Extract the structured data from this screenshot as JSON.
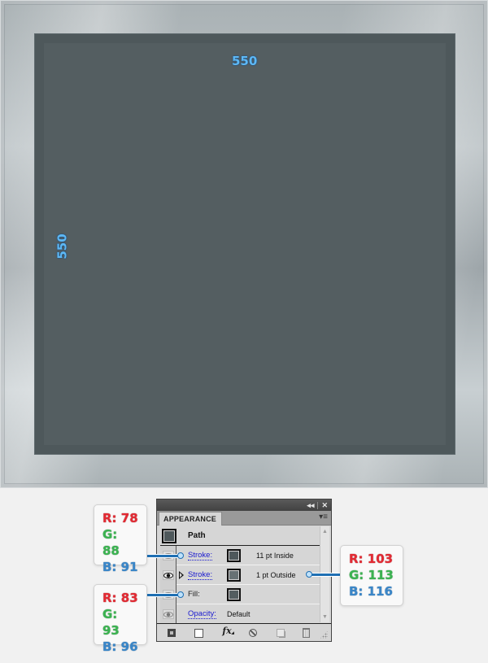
{
  "artboard": {
    "dimension_top": "550",
    "dimension_left": "550",
    "square_fill": "#545e61",
    "inner_stroke": "#4e585b",
    "outer_stroke": "#677174"
  },
  "panel": {
    "title": "APPEARANCE",
    "collapse_icon": "◂◂",
    "close_icon": "✕",
    "menu_icon": "▾≡",
    "header": {
      "label": "Path"
    },
    "rows": [
      {
        "label": "Stroke:",
        "value": "11 pt  Inside",
        "visible": false,
        "swatch": "#4e585b"
      },
      {
        "label": "Stroke:",
        "value": "1 pt  Outside",
        "visible": true,
        "swatch": "#677174"
      },
      {
        "label": "Fill:",
        "value": "",
        "visible": false,
        "swatch": "#535d60"
      },
      {
        "label": "Opacity:",
        "value": "Default",
        "visible": false
      }
    ],
    "footer": {
      "add_new_stroke": "add-new-stroke",
      "add_new_fill": "add-new-fill",
      "fx_label": "fx",
      "clear_appearance": "clear-appearance",
      "duplicate_item": "duplicate-selected-item",
      "delete_item": "delete-selected-item"
    }
  },
  "callouts": [
    {
      "r": "R: 78",
      "g": "G: 88",
      "b": "B: 91"
    },
    {
      "r": "R: 83",
      "g": "G: 93",
      "b": "B: 96"
    },
    {
      "r": "R: 103",
      "g": "G: 113",
      "b": "B: 116"
    }
  ]
}
